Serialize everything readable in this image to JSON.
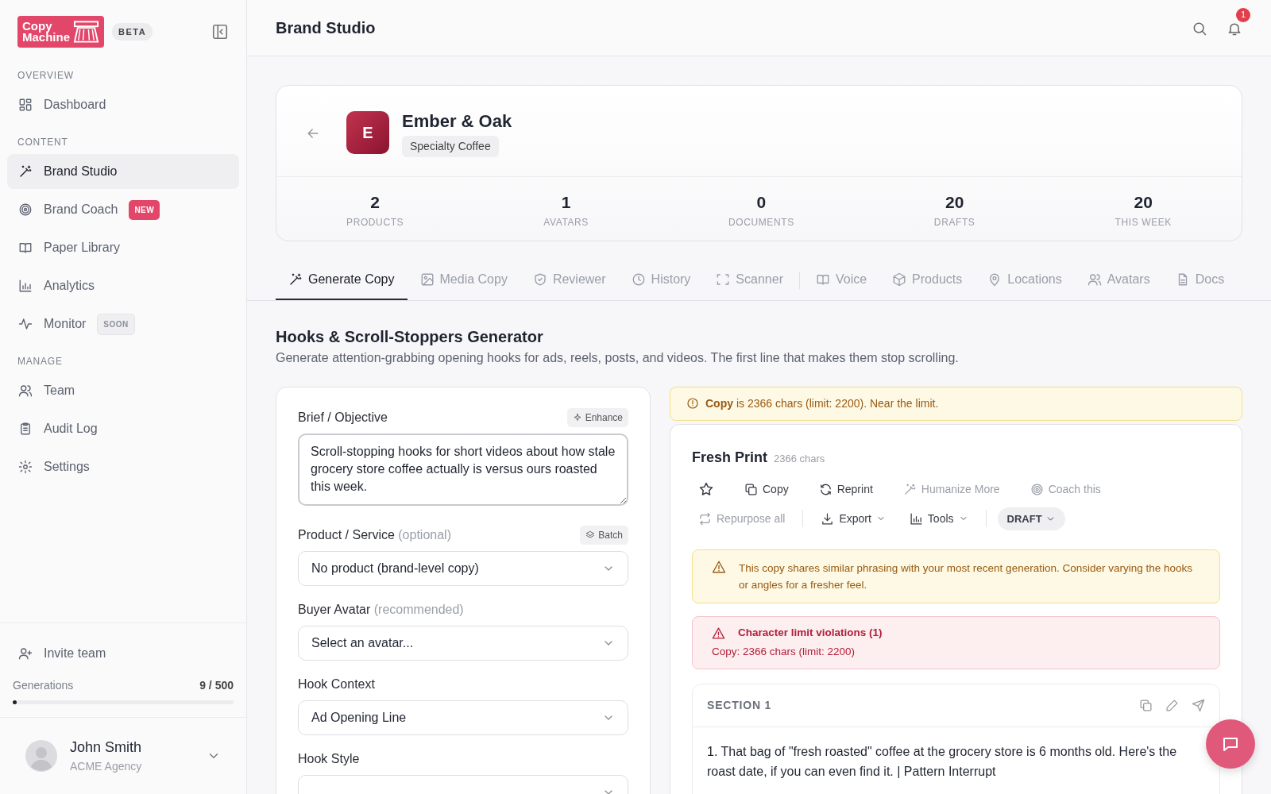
{
  "sidebar": {
    "logo": {
      "line1": "Copy",
      "line2": "Machine"
    },
    "beta": "BETA",
    "sections": [
      {
        "heading": "OVERVIEW",
        "items": [
          {
            "label": "Dashboard",
            "selected": false
          }
        ]
      },
      {
        "heading": "CONTENT",
        "items": [
          {
            "label": "Brand Studio",
            "selected": true
          },
          {
            "label": "Brand Coach",
            "selected": false,
            "badge": {
              "text": "NEW",
              "kind": "new"
            }
          },
          {
            "label": "Paper Library",
            "selected": false
          },
          {
            "label": "Analytics",
            "selected": false
          },
          {
            "label": "Monitor",
            "selected": false,
            "badge": {
              "text": "SOON",
              "kind": "soon"
            }
          }
        ]
      },
      {
        "heading": "MANAGE",
        "items": [
          {
            "label": "Team",
            "selected": false
          },
          {
            "label": "Audit Log",
            "selected": false
          },
          {
            "label": "Settings",
            "selected": false
          }
        ]
      }
    ],
    "invite": "Invite team",
    "usage": {
      "label": "Generations",
      "count": "9 / 500",
      "level": 0.018
    },
    "user": {
      "name": "John Smith",
      "org": "ACME Agency"
    }
  },
  "header": {
    "title": "Brand Studio",
    "notifications": "1"
  },
  "brand": {
    "initial": "E",
    "name": "Ember & Oak",
    "tag": "Specialty Coffee",
    "stats": [
      {
        "value": "2",
        "label": "PRODUCTS"
      },
      {
        "value": "1",
        "label": "AVATARS"
      },
      {
        "value": "0",
        "label": "DOCUMENTS"
      },
      {
        "value": "20",
        "label": "DRAFTS"
      },
      {
        "value": "20",
        "label": "THIS WEEK"
      }
    ]
  },
  "tabs": [
    {
      "label": "Generate Copy",
      "selected": true
    },
    {
      "label": "Media Copy",
      "selected": false
    },
    {
      "label": "Reviewer",
      "selected": false
    },
    {
      "label": "History",
      "selected": false
    },
    {
      "label": "Scanner",
      "selected": false
    },
    {
      "label": "Voice",
      "selected": false,
      "divider_before": true
    },
    {
      "label": "Products",
      "selected": false
    },
    {
      "label": "Locations",
      "selected": false
    },
    {
      "label": "Avatars",
      "selected": false
    },
    {
      "label": "Docs",
      "selected": false
    }
  ],
  "generator": {
    "title": "Hooks & Scroll-Stoppers Generator",
    "description": "Generate attention-grabbing opening hooks for ads, reels, posts, and videos. The first line that makes them stop scrolling."
  },
  "form": [
    {
      "kind": "textarea",
      "label": "Brief / Objective",
      "action": "Enhance",
      "value": "Scroll-stopping hooks for short videos about how stale grocery store coffee actually is versus ours roasted this week."
    },
    {
      "kind": "select",
      "label": "Product / Service",
      "hint": "(optional)",
      "action": "Batch",
      "value": "No product (brand-level copy)"
    },
    {
      "kind": "select",
      "label": "Buyer Avatar",
      "hint": "(recommended)",
      "placeholder": "Select an avatar..."
    },
    {
      "kind": "select",
      "label": "Hook Context",
      "value": "Ad Opening Line"
    },
    {
      "kind": "select",
      "label": "Hook Style"
    }
  ],
  "result": {
    "notice": "**Copy** is 2366 chars (limit: 2200). Near the limit.",
    "title": "Fresh Print",
    "chars": "2366 chars",
    "actions": [
      [
        {
          "kind": "star",
          "disabled": false
        },
        {
          "label": "Copy",
          "disabled": false
        },
        {
          "label": "Reprint",
          "disabled": false
        },
        {
          "label": "Humanize More",
          "disabled": true
        },
        {
          "label": "Coach this",
          "disabled": true
        }
      ],
      [
        {
          "label": "Repurpose all",
          "disabled": true
        },
        {
          "label": "Export",
          "disabled": false,
          "caret": true
        },
        {
          "label": "Tools",
          "disabled": false,
          "caret": true
        },
        {
          "kind": "status",
          "label": "DRAFT",
          "caret": true
        }
      ]
    ],
    "warning": "This copy shares similar phrasing with your most recent generation. Consider varying the hooks or angles for a fresher feel.",
    "error": {
      "title": "Character limit violations (1)",
      "detail": "Copy: 2366 chars (limit: 2200)"
    },
    "section": {
      "title": "SECTION 1",
      "text": "1. That bag of \"fresh roasted\" coffee at the grocery store is 6 months old. Here's the roast date, if you can even find it. | Pattern Interrupt"
    }
  }
}
